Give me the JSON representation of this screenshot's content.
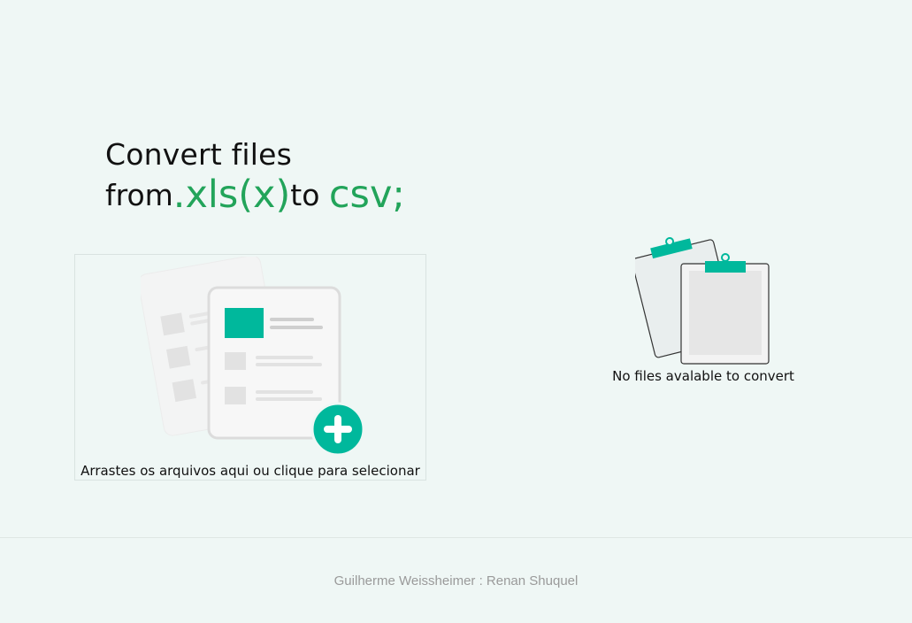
{
  "hero": {
    "line1": "Convert files",
    "from": "from",
    "source_format": ".xls(x)",
    "to": "to",
    "target_format": "csv;"
  },
  "dropzone": {
    "label": "Arrastes os arquivos aqui ou clique para selecionar",
    "icons": [
      "documents-illustration-icon",
      "add-circle-icon"
    ]
  },
  "empty_state": {
    "message": "No files avalable to convert",
    "icon": "empty-clipboards-icon"
  },
  "footer": {
    "credits": "Guilherme Weissheimer : Renan Shuquel"
  },
  "colors": {
    "background": "#eff7f5",
    "accent_green": "#22a45a",
    "teal": "#00b89c",
    "footer_text": "#9a9a9a"
  }
}
